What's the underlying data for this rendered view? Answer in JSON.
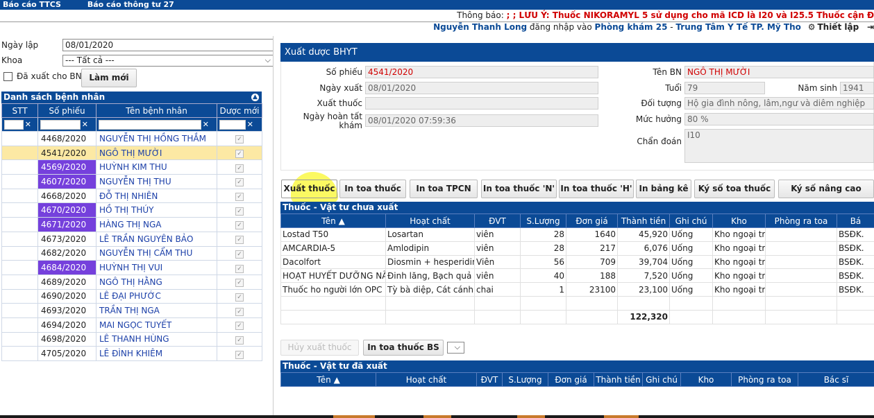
{
  "topbar": {
    "items": [
      "Báo cáo TTCS",
      "Báo cáo thông tư 27"
    ]
  },
  "notice": {
    "label": "Thông báo: ",
    "message": "; ; LƯU Ý: Thuốc NIKORAMYL 5 sử dụng cho mã ICD là I20 và I25.5 Thuốc cận Đ"
  },
  "login": {
    "user": "Nguyễn Thanh Long",
    "mid": " đăng nhập vào ",
    "room": "Phòng khám 25",
    "dash": " - ",
    "center": "Trung Tâm Y Tế TP. Mỹ Tho",
    "settings": "Thiết lập"
  },
  "left": {
    "date_label": "Ngày lập",
    "date_value": "08/01/2020",
    "dept_label": "Khoa",
    "dept_value": "--- Tất cả ---",
    "exported_label": "Đã xuất cho BN",
    "refresh": "Làm mới",
    "list_title": "Danh sách bệnh nhân",
    "cols": [
      "STT",
      "Số phiếu",
      "Tên bệnh nhân",
      "Dược mới"
    ],
    "rows": [
      {
        "id": "4468/2020",
        "name": "NGUYỄN THỊ HỒNG THẮM"
      },
      {
        "id": "4541/2020",
        "name": "NGÔ THỊ MƯỜI"
      },
      {
        "id": "4569/2020",
        "name": "HUỲNH KIM THU"
      },
      {
        "id": "4607/2020",
        "name": "NGUYỄN THỊ THU"
      },
      {
        "id": "4668/2020",
        "name": "ĐỖ THỊ NHIÊN"
      },
      {
        "id": "4670/2020",
        "name": "HỒ THỊ THÚY"
      },
      {
        "id": "4671/2020",
        "name": "HÀNG THỊ NGA"
      },
      {
        "id": "4673/2020",
        "name": "LÊ TRẦN NGUYÊN BẢO"
      },
      {
        "id": "4682/2020",
        "name": "NGUYỄN THỊ CẨM THU"
      },
      {
        "id": "4684/2020",
        "name": "HUỲNH THỊ VUI"
      },
      {
        "id": "4689/2020",
        "name": "NGÔ THỊ HẰNG"
      },
      {
        "id": "4690/2020",
        "name": "LÊ ĐẠI PHƯỚC"
      },
      {
        "id": "4693/2020",
        "name": "TRẦN THỊ NGA"
      },
      {
        "id": "4694/2020",
        "name": "MAI NGỌC TUYẾT"
      },
      {
        "id": "4698/2020",
        "name": "LÊ THANH HÙNG"
      },
      {
        "id": "4705/2020",
        "name": "LÊ ĐÌNH KHIÊM"
      }
    ]
  },
  "form": {
    "title": "Xuất dược BHYT",
    "so_phieu_label": "Số phiếu",
    "so_phieu": "4541/2020",
    "ngay_xuat_label": "Ngày xuất",
    "ngay_xuat": "08/01/2020",
    "xuat_thuoc_label": "Xuất thuốc",
    "xuat_thuoc": "",
    "ngay_hoan_tat_label_1": "Ngày hoàn tất",
    "ngay_hoan_tat_label_2": "khám",
    "ngay_hoan_tat": "08/01/2020 07:59:36",
    "ten_bn_label": "Tên BN",
    "ten_bn": "NGÔ THỊ MƯỜI",
    "tuoi_label": "Tuổi",
    "tuoi": "79",
    "nam_sinh_label": "Năm sinh",
    "nam_sinh": "1941",
    "doi_tuong_label": "Đối tượng",
    "doi_tuong": "Hộ gia đình nông, lâm,ngư và diêm nghiệp",
    "muc_huong_label": "Mức hưởng",
    "muc_huong": "80 %",
    "chan_doan_label": "Chẩn đoán",
    "chan_doan": "I10"
  },
  "actions": [
    "Xuất thuốc",
    "In toa thuốc",
    "In toa TPCN",
    "In toa thuốc 'N'",
    "In toa thuốc 'H'",
    "In bảng kê",
    "Ký số toa thuốc",
    "Ký số nâng cao"
  ],
  "pending": {
    "title": "Thuốc - Vật tư chưa xuất",
    "cols": [
      "Tên ▲",
      "Hoạt chất",
      "ĐVT",
      "S.Lượng",
      "Đơn giá",
      "Thành tiền",
      "Ghi chú",
      "Kho",
      "Phòng ra toa",
      "Bá"
    ],
    "rows": [
      [
        "Lostad T50",
        "Losartan",
        "viên",
        "28",
        "1640",
        "45,920",
        "Uống",
        "Kho ngoại trú",
        "",
        "BSĐK."
      ],
      [
        "AMCARDIA-5",
        "Amlodipin",
        "viên",
        "28",
        "217",
        "6,076",
        "Uống",
        "Kho ngoại trú",
        "",
        "BSĐK."
      ],
      [
        "Dacolfort",
        "Diosmin + hesperidin",
        "Viên",
        "56",
        "709",
        "39,704",
        "Uống",
        "Kho ngoại trú",
        "",
        "BSĐK."
      ],
      [
        "HOẠT HUYẾT DƯỠNG NÃO",
        "Đinh lăng, Bạch quả",
        "viên",
        "40",
        "188",
        "7,520",
        "Uống",
        "Kho ngoại trú",
        "",
        "BSĐK."
      ],
      [
        "Thuốc ho người lớn OPC",
        "Tỳ bà diệp, Cát cánh,",
        "chai",
        "1",
        "23100",
        "23,100",
        "Uống",
        "Kho ngoại trú",
        "",
        "BSĐK."
      ]
    ],
    "total": "122,320"
  },
  "mid_actions": {
    "cancel": "Hủy xuất thuốc",
    "print_bs": "In toa thuốc BS"
  },
  "exported": {
    "title": "Thuốc - Vật tư đã xuất",
    "cols": [
      "Tên ▲",
      "Hoạt chất",
      "ĐVT",
      "S.Lượng",
      "Đơn giá",
      "Thành tiền",
      "Ghi chú",
      "Kho",
      "Phòng ra toa",
      "Bác sĩ"
    ]
  }
}
